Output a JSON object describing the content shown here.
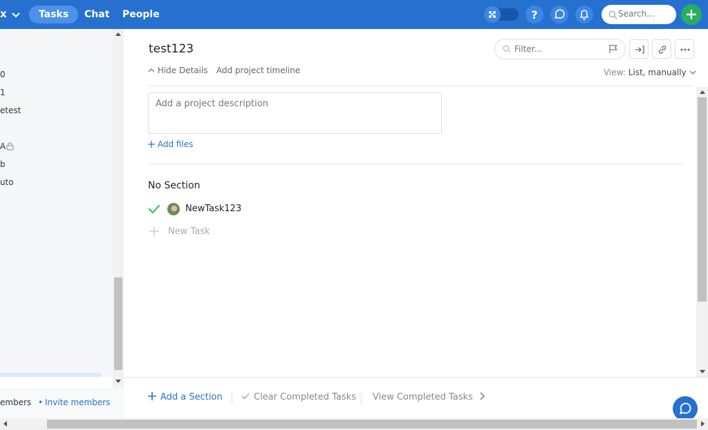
{
  "topbar": {
    "brand": "x",
    "tabs": [
      {
        "label": "Tasks",
        "active": true
      },
      {
        "label": "Chat",
        "active": false
      },
      {
        "label": "People",
        "active": false
      }
    ],
    "search_placeholder": "Search...",
    "icons": [
      "apps-toggle-icon",
      "help-icon",
      "chat-icon",
      "bell-icon",
      "search-icon",
      "plus-icon"
    ]
  },
  "sidebar": {
    "items": [
      {
        "label": "0"
      },
      {
        "label": "1"
      },
      {
        "label": "etest"
      },
      {
        "label": ""
      },
      {
        "label": "A"
      },
      {
        "label": "b"
      },
      {
        "label": "uto"
      }
    ],
    "footer": {
      "members_label": "embers",
      "dot": "•",
      "invite_label": "Invite members"
    }
  },
  "project": {
    "title": "test123",
    "filter_placeholder": "Filter...",
    "hide_details": "Hide Details",
    "add_timeline": "Add project timeline",
    "view_label": "View:",
    "view_value": "List, manually",
    "description_placeholder": "Add a project description",
    "add_files": "Add files"
  },
  "sections": [
    {
      "title": "No Section",
      "tasks": [
        {
          "name": "NewTask123",
          "completed": true
        }
      ],
      "new_task_placeholder": "New Task"
    }
  ],
  "footer": {
    "add_section": "Add a Section",
    "clear_completed": "Clear Completed Tasks",
    "view_completed": "View Completed Tasks"
  },
  "colors": {
    "brand_blue": "#2670d0",
    "accent_green": "#27ae60",
    "check_green": "#4cc06a"
  }
}
